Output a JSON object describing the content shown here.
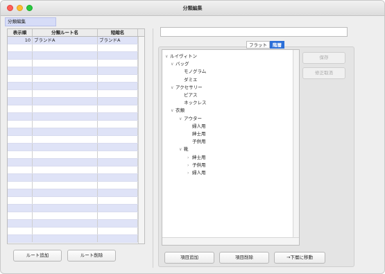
{
  "window": {
    "title": "分類編集"
  },
  "tab": {
    "label": "分類編集"
  },
  "table": {
    "columns": [
      "表示順",
      "分類ルート名",
      "短縮名"
    ],
    "rows": [
      {
        "order": "10",
        "name": "ブランドA",
        "short": "ブランドA"
      }
    ]
  },
  "left_buttons": {
    "add_root": "ルート追加",
    "delete_root": "ルート削除"
  },
  "view_toggle": {
    "options": [
      "フラット",
      "階層"
    ],
    "selected": "階層"
  },
  "side_buttons": {
    "save": "保存",
    "undo": "修正取消"
  },
  "bottom_buttons": {
    "add_item": "項目追加",
    "delete_item": "項目削除",
    "move_down": "→下層に移動"
  },
  "tree": [
    {
      "label": "ルイヴィトン",
      "level": 0,
      "twisty": "expanded"
    },
    {
      "label": "バッグ",
      "level": 1,
      "twisty": "expanded"
    },
    {
      "label": "モノグラム",
      "level": 2,
      "twisty": "none"
    },
    {
      "label": "ダミエ",
      "level": 2,
      "twisty": "none"
    },
    {
      "label": "アクセサリー",
      "level": 1,
      "twisty": "expanded"
    },
    {
      "label": "ピアス",
      "level": 2,
      "twisty": "none"
    },
    {
      "label": "ネックレス",
      "level": 2,
      "twisty": "none"
    },
    {
      "label": "衣類",
      "level": 1,
      "twisty": "expanded"
    },
    {
      "label": "アウター",
      "level": 2,
      "twisty": "expanded"
    },
    {
      "label": "婦人用",
      "level": 3,
      "twisty": "none"
    },
    {
      "label": "紳士用",
      "level": 3,
      "twisty": "none"
    },
    {
      "label": "子供用",
      "level": 3,
      "twisty": "none"
    },
    {
      "label": "靴",
      "level": 2,
      "twisty": "expanded"
    },
    {
      "label": "紳士用",
      "level": 3,
      "twisty": "collapsed"
    },
    {
      "label": "子供用",
      "level": 3,
      "twisty": "collapsed"
    },
    {
      "label": "婦人用",
      "level": 3,
      "twisty": "collapsed"
    }
  ],
  "colors": {
    "accent": "#2b6fd8",
    "row_stripe": "#dfe3f7",
    "tab_bg": "#d6dcf7"
  }
}
